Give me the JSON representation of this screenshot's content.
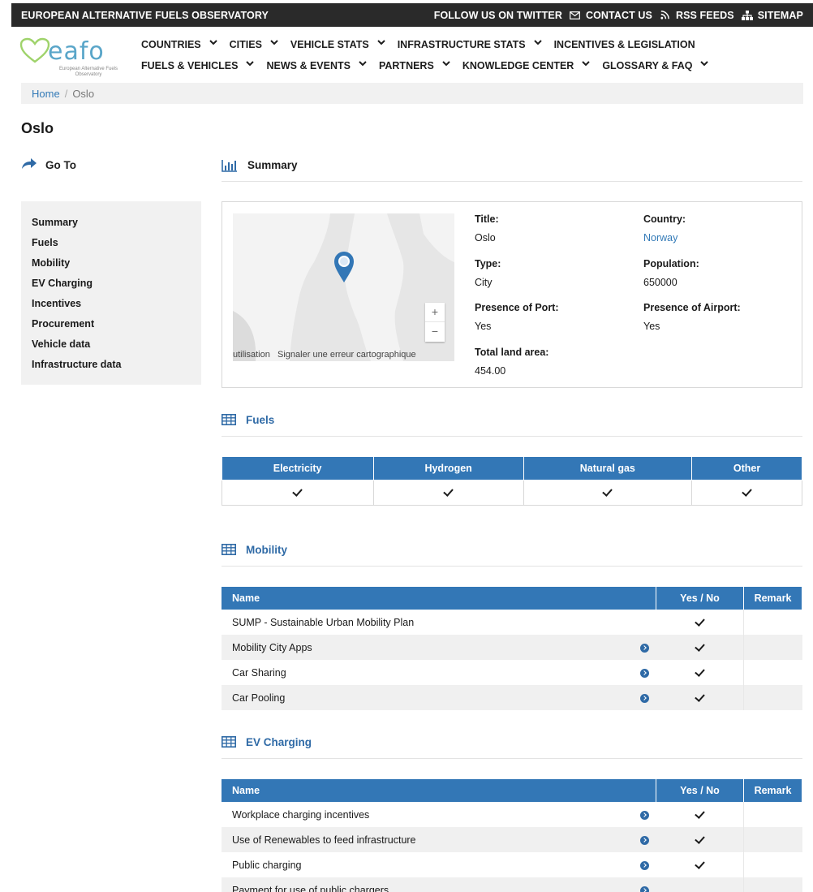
{
  "topbar": {
    "site_name": "EUROPEAN ALTERNATIVE FUELS OBSERVATORY",
    "links": [
      {
        "label": "FOLLOW US ON TWITTER",
        "icon": "twitter-icon"
      },
      {
        "label": "CONTACT US",
        "icon": "mail-icon"
      },
      {
        "label": "RSS FEEDS",
        "icon": "rss-icon"
      },
      {
        "label": "SITEMAP",
        "icon": "sitemap-icon"
      }
    ]
  },
  "logo": {
    "word": "eafo",
    "tagline": "European Alternative Fuels Observatory"
  },
  "nav": {
    "row1": [
      "COUNTRIES",
      "CITIES",
      "VEHICLE STATS",
      "INFRASTRUCTURE STATS",
      "INCENTIVES & LEGISLATION"
    ],
    "row2": [
      "FUELS & VEHICLES",
      "NEWS & EVENTS",
      "PARTNERS",
      "KNOWLEDGE CENTER",
      "GLOSSARY & FAQ"
    ]
  },
  "breadcrumb": {
    "home": "Home",
    "separator": "/",
    "current": "Oslo"
  },
  "page_title": "Oslo",
  "sidebar": {
    "goto_label": "Go To",
    "items": [
      "Summary",
      "Fuels",
      "Mobility",
      "EV Charging",
      "Incentives",
      "Procurement",
      "Vehicle data",
      "Infrastructure data"
    ]
  },
  "summary": {
    "heading": "Summary",
    "map": {
      "zoom_in": "+",
      "zoom_out": "−",
      "footer_left": "utilisation",
      "footer_right": "Signaler une erreur cartographique"
    },
    "fields": {
      "title": {
        "label": "Title:",
        "value": "Oslo"
      },
      "country": {
        "label": "Country:",
        "value": "Norway"
      },
      "type": {
        "label": "Type:",
        "value": "City"
      },
      "population": {
        "label": "Population:",
        "value": "650000"
      },
      "port": {
        "label": "Presence of Port:",
        "value": "Yes"
      },
      "airport": {
        "label": "Presence of Airport:",
        "value": "Yes"
      },
      "land_area": {
        "label": "Total land area:",
        "value": "454.00"
      }
    }
  },
  "fuels": {
    "heading": "Fuels",
    "columns": [
      "Electricity",
      "Hydrogen",
      "Natural gas",
      "Other"
    ],
    "values": [
      true,
      true,
      true,
      true
    ]
  },
  "mobility": {
    "heading": "Mobility",
    "columns": {
      "name": "Name",
      "yesno": "Yes / No",
      "remark": "Remark"
    },
    "rows": [
      {
        "name": "SUMP - Sustainable Urban Mobility Plan",
        "has_info": false,
        "yes": true
      },
      {
        "name": "Mobility City Apps",
        "has_info": true,
        "yes": true
      },
      {
        "name": "Car Sharing",
        "has_info": true,
        "yes": true
      },
      {
        "name": "Car Pooling",
        "has_info": true,
        "yes": true
      }
    ]
  },
  "ev_charging": {
    "heading": "EV Charging",
    "columns": {
      "name": "Name",
      "yesno": "Yes / No",
      "remark": "Remark"
    },
    "rows": [
      {
        "name": "Workplace charging incentives",
        "has_info": true,
        "yes": true
      },
      {
        "name": "Use of Renewables to feed infrastructure",
        "has_info": true,
        "yes": true
      },
      {
        "name": "Public charging",
        "has_info": true,
        "yes": true
      },
      {
        "name": "Payment for use of public chargers",
        "has_info": true,
        "yes": false
      }
    ]
  },
  "colors": {
    "accent": "#3377b6",
    "link": "#337ab7",
    "logo": "#5aa6c9",
    "topbar": "#2a2a2a"
  }
}
